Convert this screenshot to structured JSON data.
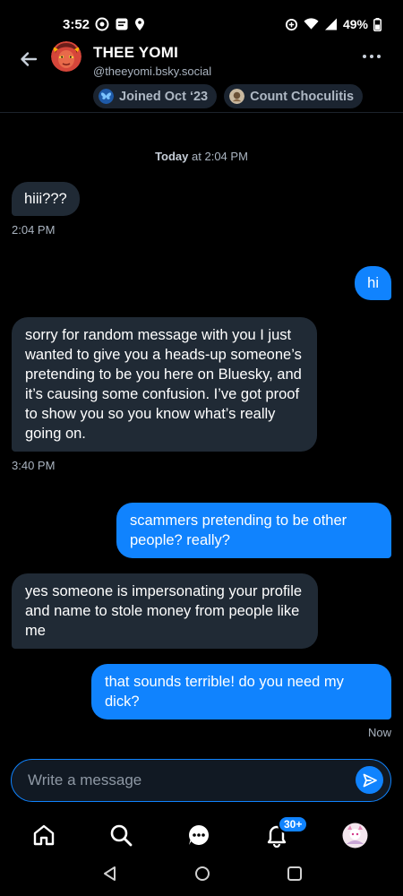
{
  "status_bar": {
    "time": "3:52",
    "battery": "49%"
  },
  "header": {
    "title": "THEE YOMI",
    "handle": "@theeyomi.bsky.social",
    "chips": [
      {
        "label": "Joined Oct ‘23",
        "icon": "bluesky-butterfly-icon"
      },
      {
        "label": "Count Choculitis",
        "icon": "starter-pack-avatar-icon"
      }
    ]
  },
  "conversation": {
    "date_separator_bold": "Today",
    "date_separator_rest": "at 2:04 PM",
    "messages": [
      {
        "from": "them",
        "text": "hiii???"
      },
      {
        "from": "me",
        "text": "hi"
      },
      {
        "from": "them",
        "text": "sorry for random message with you I just wanted to give you a heads-up someone’s pretending to be you here on Bluesky, and it’s causing some confusion. I’ve got proof to show you so you know what’s really going on."
      },
      {
        "from": "me",
        "text": "scammers pretending to be other people? really?"
      },
      {
        "from": "them",
        "text": "yes someone is impersonating your profile and name to stole money from people like me"
      },
      {
        "from": "me",
        "text": "that sounds terrible! do you need my dick?"
      }
    ],
    "timestamps": [
      "2:04 PM",
      "3:40 PM",
      "Now"
    ]
  },
  "composer": {
    "placeholder": "Write a message"
  },
  "bottom_nav": {
    "items": [
      "home-icon",
      "search-icon",
      "chat-icon",
      "notifications-icon",
      "profile-avatar"
    ],
    "notification_badge": "30+"
  },
  "colors": {
    "accent": "#1083fe",
    "incoming_bubble": "#202a35",
    "background": "#000000"
  }
}
